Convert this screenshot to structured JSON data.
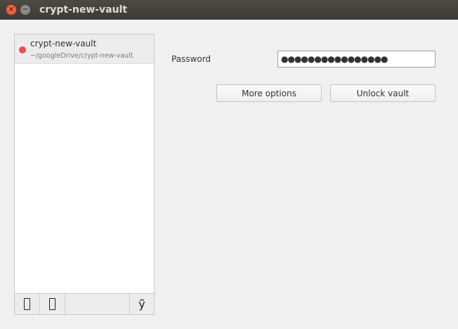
{
  "window": {
    "title": "crypt-new-vault",
    "close_glyph": "×",
    "minimize_glyph": "−"
  },
  "vaults": [
    {
      "name": "crypt-new-vault",
      "path": "~/googleDrive/crypt-new-vault",
      "status_color": "#f04b4b",
      "locked": true
    }
  ],
  "toolbar": {
    "add_icon": "add-vault-icon",
    "remove_icon": "remove-vault-icon",
    "settings_icon": "settings-icon",
    "settings_glyph": "ỹ"
  },
  "unlock": {
    "password_label": "Password",
    "password_value": "●●●●●●●●●●●●●●●●",
    "more_options_label": "More options",
    "unlock_label": "Unlock vault"
  }
}
